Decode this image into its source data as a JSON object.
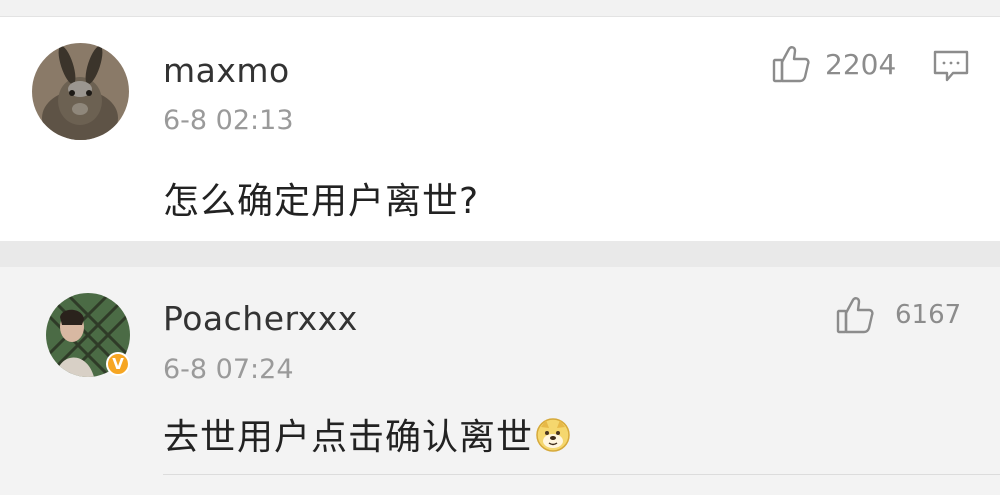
{
  "comments": [
    {
      "username": "maxmo",
      "time": "6-8 02:13",
      "text": "怎么确定用户离世?",
      "likes": "2204",
      "avatar_icon": "rabbit-avatar",
      "has_reply_icon": true
    },
    {
      "username": "Poacherxxx",
      "time": "6-8 07:24",
      "text": "去世用户点击确认离世",
      "emoji_icon": "doge-emoji",
      "likes": "6167",
      "avatar_icon": "person-avatar",
      "verified_badge": "V"
    }
  ],
  "colors": {
    "username": "#333333",
    "timestamp": "#9a9a9a",
    "badge": "#f6a623"
  }
}
